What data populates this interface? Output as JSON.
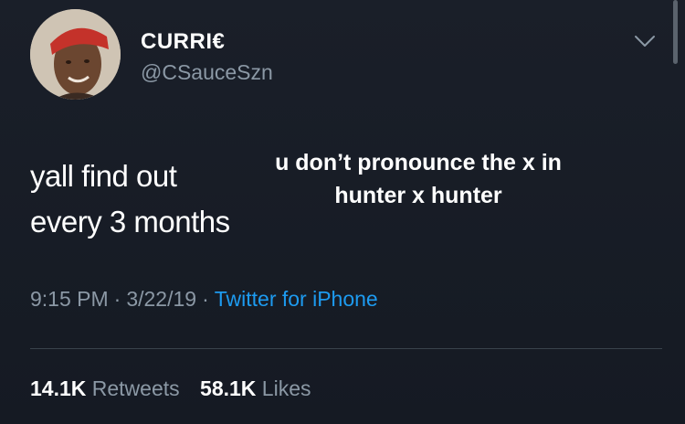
{
  "user": {
    "display_name": "CURRI€",
    "handle": "@CSauceSzn"
  },
  "tweet": {
    "lines": [
      "yall find out",
      "every 3 months"
    ]
  },
  "overlay": {
    "lines": [
      "u don’t pronounce the x in",
      "hunter x hunter"
    ]
  },
  "meta": {
    "time": "9:15 PM",
    "separator": "·",
    "date": "3/22/19",
    "source": "Twitter for iPhone"
  },
  "stats": {
    "retweets_count": "14.1K",
    "retweets_label": "Retweets",
    "likes_count": "58.1K",
    "likes_label": "Likes"
  },
  "icons": {
    "menu": "chevron-down-icon"
  },
  "colors": {
    "background": "#181d26",
    "text": "#ffffff",
    "secondary": "#8b98a5",
    "link": "#1d9bf0"
  }
}
